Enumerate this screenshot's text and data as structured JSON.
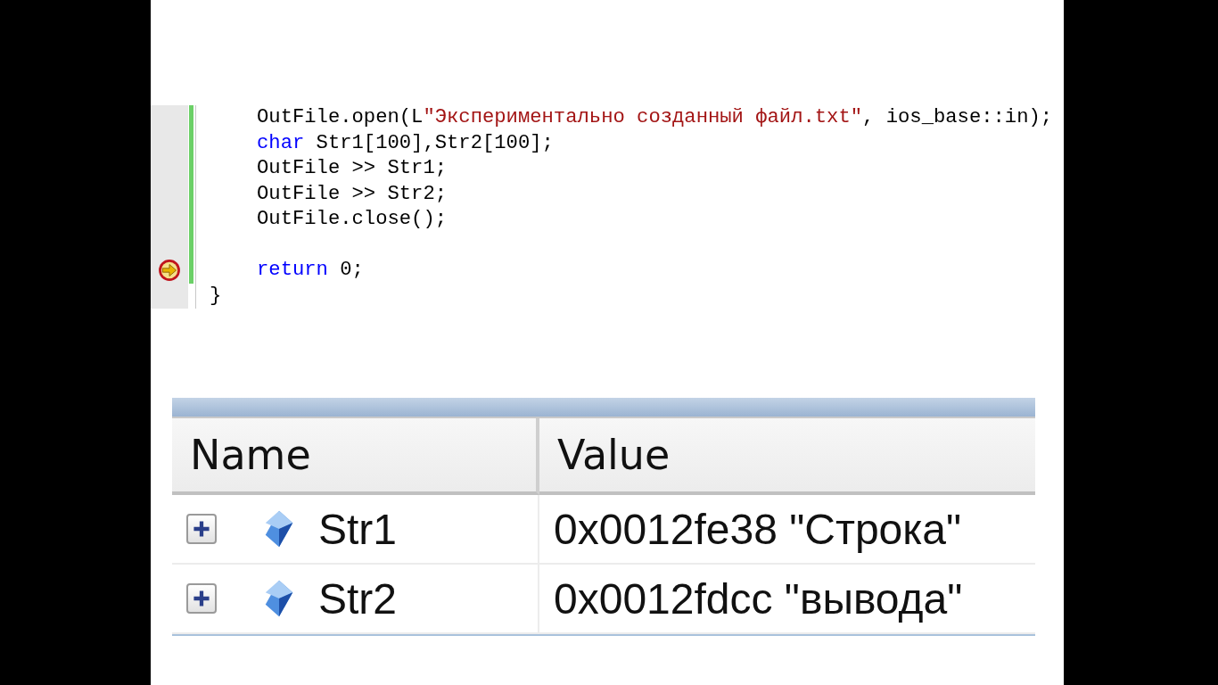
{
  "code_editor": {
    "lines": [
      {
        "kind": "block",
        "children": [
          {
            "kind": "line",
            "changed": true,
            "current": false,
            "tokens": [
              {
                "kind": "plain",
                "text": "OutFile.open(L"
              },
              {
                "kind": "string",
                "text": "\"Экспериментально созданный файл.txt\""
              },
              {
                "kind": "plain",
                "text": ", ios_base::in);"
              }
            ]
          },
          {
            "kind": "line",
            "changed": true,
            "current": false,
            "tokens": [
              {
                "kind": "keyword",
                "text": "char"
              },
              {
                "kind": "plain",
                "text": " Str1[100],Str2[100];"
              }
            ]
          },
          {
            "kind": "line",
            "changed": true,
            "current": false,
            "tokens": [
              {
                "kind": "plain",
                "text": "OutFile >> Str1;"
              }
            ]
          },
          {
            "kind": "line",
            "changed": true,
            "current": false,
            "tokens": [
              {
                "kind": "plain",
                "text": "OutFile >> Str2;"
              }
            ]
          },
          {
            "kind": "line",
            "changed": true,
            "current": false,
            "tokens": [
              {
                "kind": "plain",
                "text": "OutFile.close();"
              }
            ]
          },
          {
            "kind": "line",
            "changed": true,
            "current": false
          },
          {
            "kind": "line",
            "changed": true,
            "current": true,
            "tokens": [
              {
                "kind": "keyword",
                "text": "return"
              },
              {
                "kind": "plain",
                "text": " 0;"
              }
            ]
          }
        ]
      },
      {
        "kind": "line",
        "changed": false,
        "current": false,
        "tokens": [
          {
            "text": "}"
          }
        ]
      }
    ]
  },
  "watch": {
    "columns": [
      "Name",
      "Value"
    ],
    "rows": [
      {
        "expanded": false,
        "name": "Str1",
        "value": "0x0012fe38 \"Строка\""
      },
      {
        "expanded": false,
        "name": "Str2",
        "value": "0x0012fdcc \"вывода\""
      }
    ]
  }
}
